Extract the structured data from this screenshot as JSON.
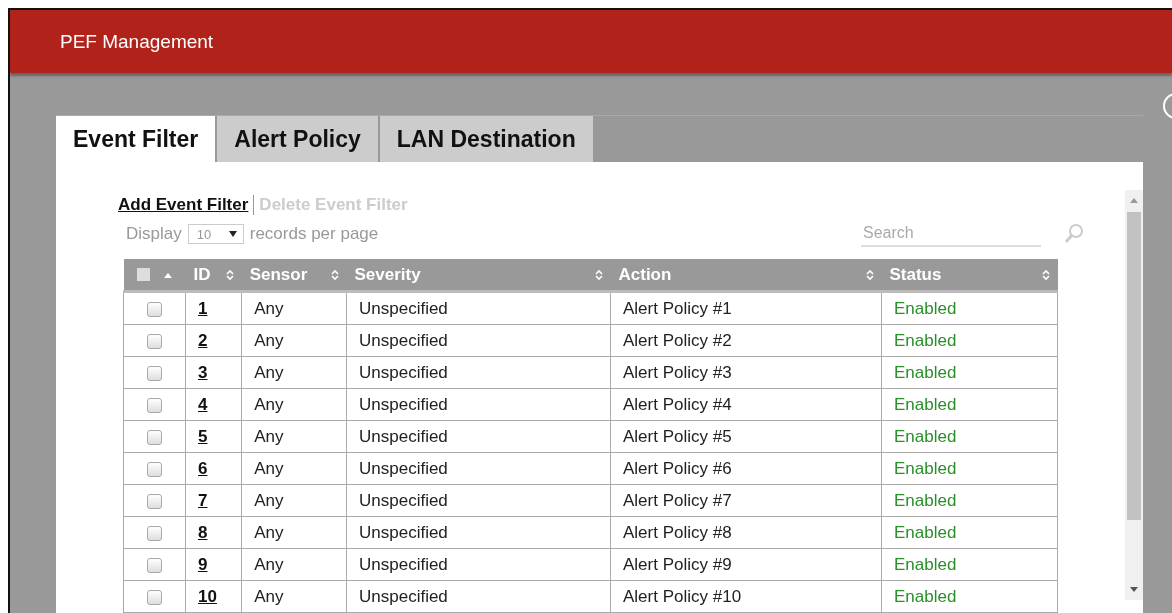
{
  "header": {
    "title": "PEF Management"
  },
  "tabs": [
    {
      "label": "Event Filter",
      "selected": true
    },
    {
      "label": "Alert Policy",
      "selected": false
    },
    {
      "label": "LAN Destination",
      "selected": false
    }
  ],
  "actions": [
    {
      "label": "Add Event Filter",
      "disabled": false
    },
    {
      "label": "Delete Event Filter",
      "disabled": true
    }
  ],
  "display": {
    "label": "Display",
    "value": "10",
    "suffix": "records per page"
  },
  "search": {
    "placeholder": "Search"
  },
  "table": {
    "select_all_checked": false,
    "columns": [
      {
        "label": "ID",
        "sortable": true
      },
      {
        "label": "Sensor",
        "sortable": true
      },
      {
        "label": "Severity",
        "sortable": true
      },
      {
        "label": "Action",
        "sortable": true
      },
      {
        "label": "Status",
        "sortable": true
      }
    ],
    "rows": [
      {
        "checked": false,
        "id": "1",
        "sensor": "Any",
        "severity": "Unspecified",
        "action": "Alert Policy #1",
        "status": "Enabled"
      },
      {
        "checked": false,
        "id": "2",
        "sensor": "Any",
        "severity": "Unspecified",
        "action": "Alert Policy #2",
        "status": "Enabled"
      },
      {
        "checked": false,
        "id": "3",
        "sensor": "Any",
        "severity": "Unspecified",
        "action": "Alert Policy #3",
        "status": "Enabled"
      },
      {
        "checked": false,
        "id": "4",
        "sensor": "Any",
        "severity": "Unspecified",
        "action": "Alert Policy #4",
        "status": "Enabled"
      },
      {
        "checked": false,
        "id": "5",
        "sensor": "Any",
        "severity": "Unspecified",
        "action": "Alert Policy #5",
        "status": "Enabled"
      },
      {
        "checked": false,
        "id": "6",
        "sensor": "Any",
        "severity": "Unspecified",
        "action": "Alert Policy #6",
        "status": "Enabled"
      },
      {
        "checked": false,
        "id": "7",
        "sensor": "Any",
        "severity": "Unspecified",
        "action": "Alert Policy #7",
        "status": "Enabled"
      },
      {
        "checked": false,
        "id": "8",
        "sensor": "Any",
        "severity": "Unspecified",
        "action": "Alert Policy #8",
        "status": "Enabled"
      },
      {
        "checked": false,
        "id": "9",
        "sensor": "Any",
        "severity": "Unspecified",
        "action": "Alert Policy #9",
        "status": "Enabled"
      },
      {
        "checked": false,
        "id": "10",
        "sensor": "Any",
        "severity": "Unspecified",
        "action": "Alert Policy #10",
        "status": "Enabled"
      }
    ]
  }
}
